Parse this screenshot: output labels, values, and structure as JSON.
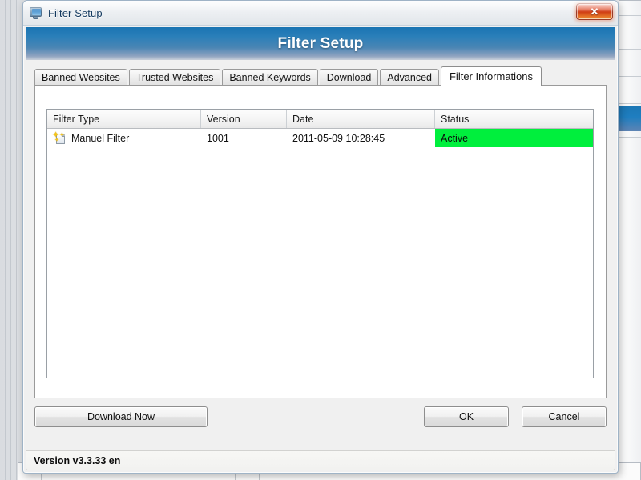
{
  "window": {
    "icon": "monitor-icon",
    "title": "Filter Setup",
    "close_label": "✕"
  },
  "banner": {
    "title": "Filter Setup"
  },
  "tabs": [
    {
      "label": "Banned Websites",
      "active": false
    },
    {
      "label": "Trusted Websites",
      "active": false
    },
    {
      "label": "Banned Keywords",
      "active": false
    },
    {
      "label": "Download",
      "active": false
    },
    {
      "label": "Advanced",
      "active": false
    },
    {
      "label": "Filter Informations",
      "active": true
    }
  ],
  "list": {
    "columns": [
      "Filter Type",
      "Version",
      "Date",
      "Status"
    ],
    "rows": [
      {
        "icon": "new-filter-icon",
        "filter_type": "Manuel Filter",
        "version": "1001",
        "date": "2011-05-09 10:28:45",
        "status": "Active",
        "status_color": "#00ef3d"
      }
    ]
  },
  "buttons": {
    "download": "Download Now",
    "ok": "OK",
    "cancel": "Cancel"
  },
  "statusbar": {
    "text": "Version v3.3.33 en"
  },
  "colors": {
    "banner_top": "#1a74b2",
    "status_active": "#00ef3d",
    "close_button": "#cf3c14",
    "title_text": "#12385e"
  }
}
